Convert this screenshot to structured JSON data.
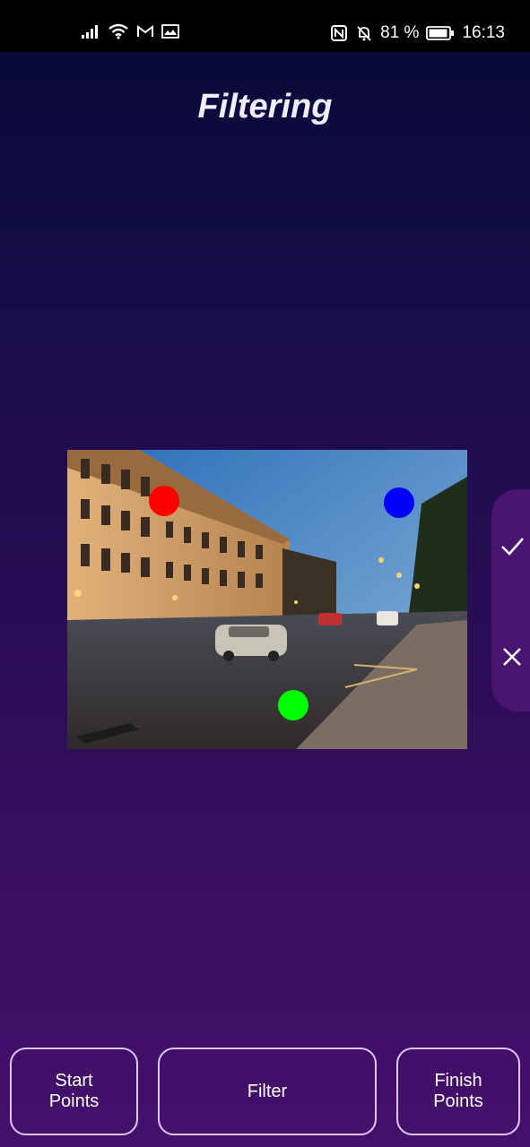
{
  "status_bar": {
    "battery_percent": "81 %",
    "time": "16:13",
    "icons": [
      "signal-icon",
      "wifi-icon",
      "gmail-icon",
      "photo-notification-icon",
      "nfc-icon",
      "bell-muted-icon",
      "battery-icon"
    ]
  },
  "header": {
    "title": "Filtering"
  },
  "image": {
    "description_icon": "street-photo",
    "markers": [
      {
        "color": "#ff0000",
        "name": "red-marker"
      },
      {
        "color": "#0000ff",
        "name": "blue-marker"
      },
      {
        "color": "#00ff00",
        "name": "green-marker"
      }
    ]
  },
  "side_panel": {
    "confirm_icon": "check-icon",
    "cancel_icon": "close-icon"
  },
  "buttons": {
    "start_points": "Start\nPoints",
    "filter": "Filter",
    "finish_points": "Finish\nPoints"
  },
  "colors": {
    "accent_border": "#d9c8ff",
    "panel": "#4a1472"
  }
}
